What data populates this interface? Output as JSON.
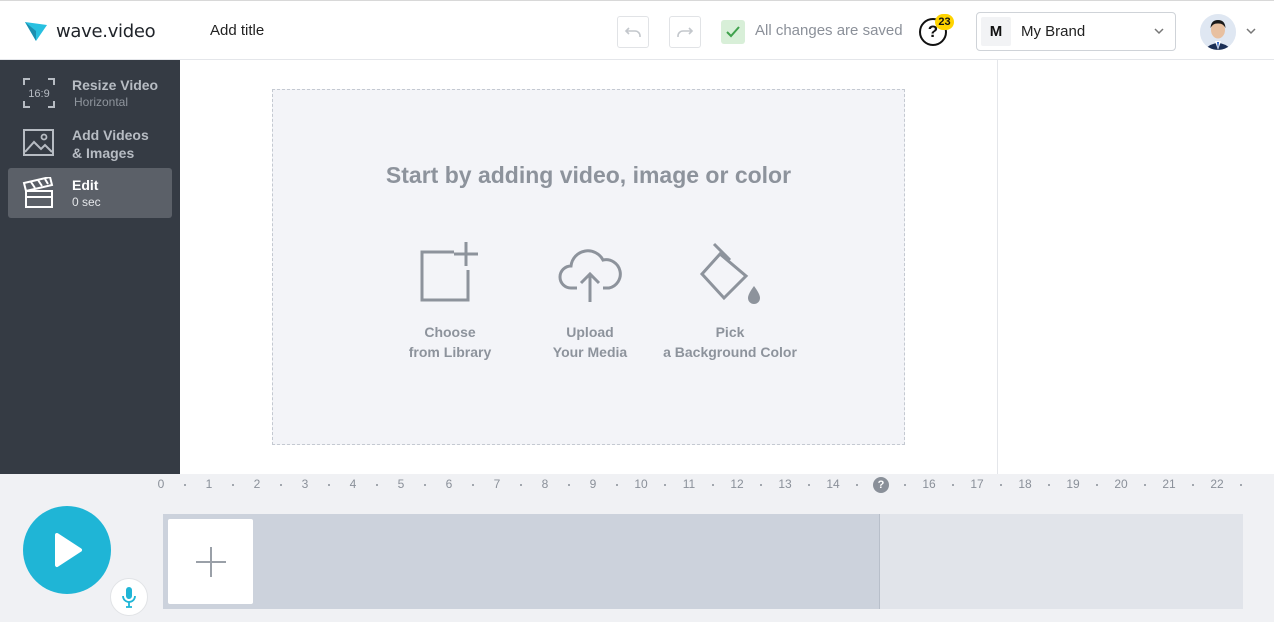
{
  "header": {
    "logo_text": "wave.video",
    "title_placeholder": "Add title",
    "save_status": "All changes are saved",
    "help_badge_count": "23",
    "brand": {
      "initial": "M",
      "name": "My Brand"
    }
  },
  "sidebar": {
    "items": [
      {
        "icon_text": "16:9",
        "label": "Resize Video",
        "sub": "Horizontal"
      },
      {
        "label_line1": "Add Videos",
        "label_line2": "& Images"
      },
      {
        "label": "Edit",
        "sub": "0 sec",
        "active": true
      }
    ]
  },
  "canvas": {
    "prompt": "Start by adding video, image or color",
    "options": [
      {
        "line1": "Choose",
        "line2": "from Library"
      },
      {
        "line1": "Upload",
        "line2": "Your Media"
      },
      {
        "line1": "Pick",
        "line2": "a Background Color"
      }
    ]
  },
  "timeline": {
    "ticks": [
      "0",
      "1",
      "2",
      "3",
      "4",
      "5",
      "6",
      "7",
      "8",
      "9",
      "10",
      "11",
      "12",
      "13",
      "14",
      "?",
      "16",
      "17",
      "18",
      "19",
      "20",
      "21",
      "22"
    ],
    "playhead_label": "?"
  },
  "colors": {
    "accent": "#1fb5d6",
    "sidebar_bg": "#353b44",
    "badge": "#ffd400",
    "save_check": "#3fa14c"
  }
}
